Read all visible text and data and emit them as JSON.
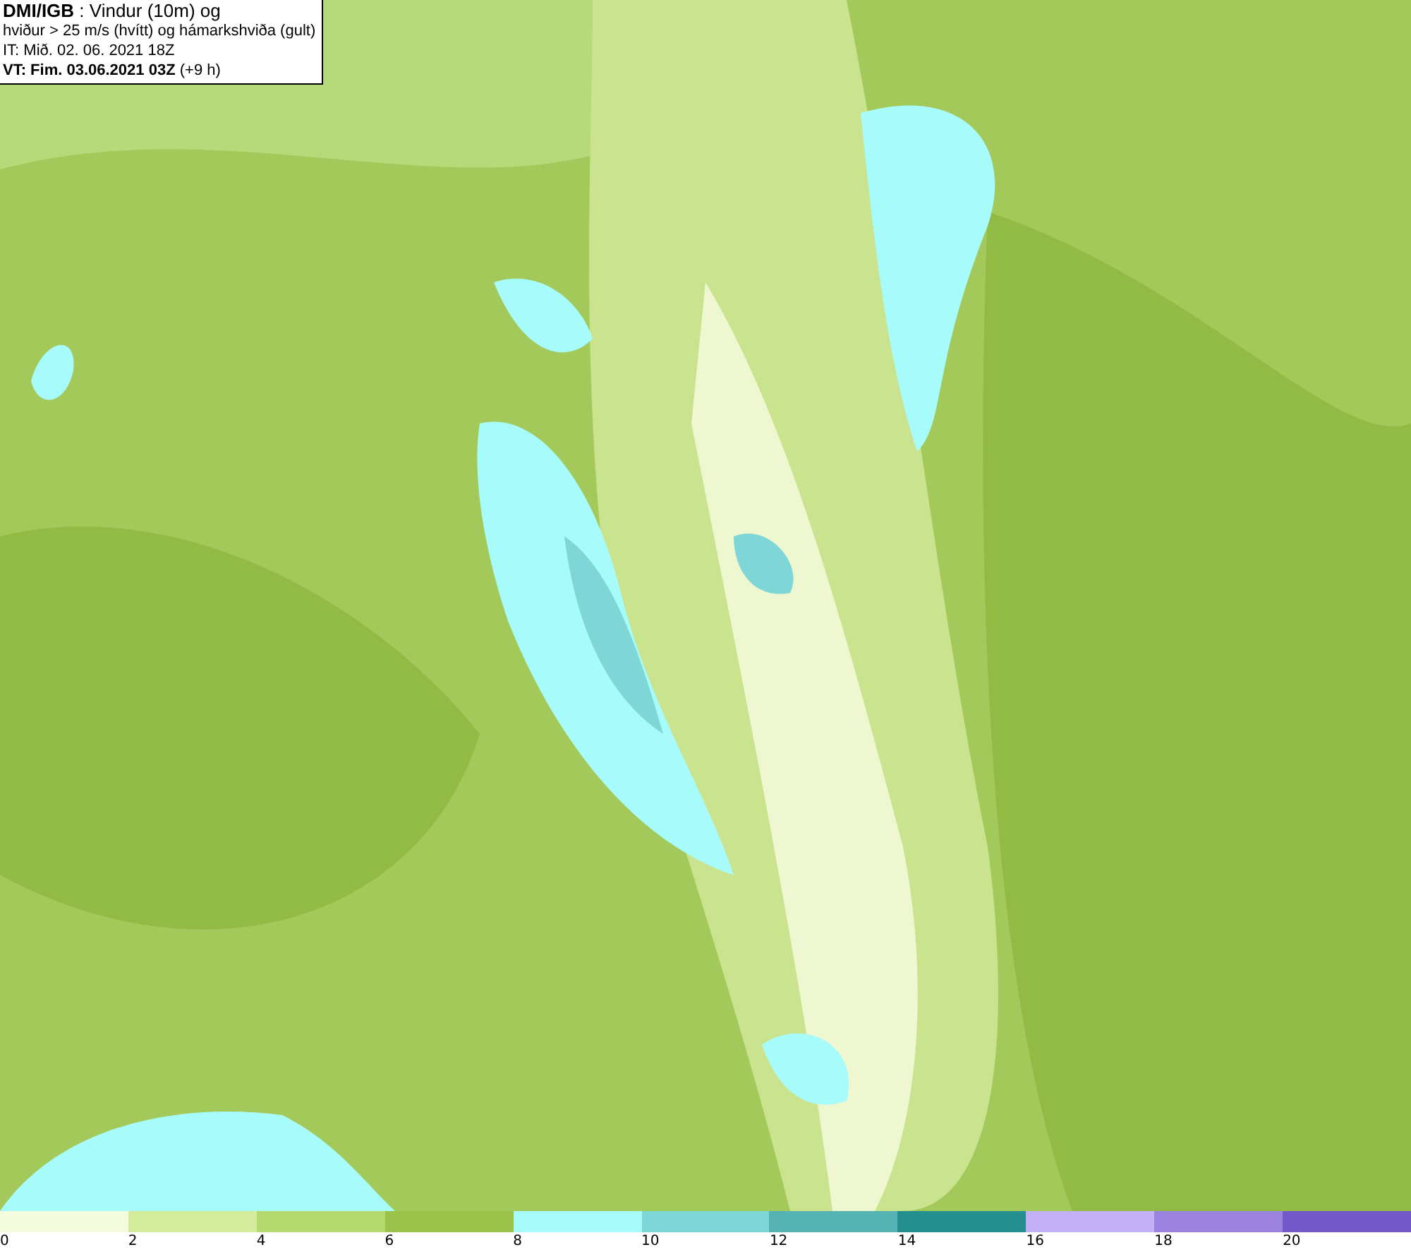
{
  "header": {
    "lines": [
      "**DMI/IGB** : Vindur (10m) og",
      "hviður > 25 m/s (hvítt) og hámarkshviða (gult)",
      "IT: Mið. 02. 06. 2021 18Z",
      "**VT: Fim. 03.06.2021 03Z** (+9 h)"
    ]
  },
  "legend": {
    "bins": [
      {
        "color": "#f5fbdf",
        "label": "0"
      },
      {
        "color": "#d4eb9c",
        "label": "2"
      },
      {
        "color": "#b5d86f",
        "label": "4"
      },
      {
        "color": "#9bc24a",
        "label": "6"
      },
      {
        "color": "#a8fbfb",
        "label": "8"
      },
      {
        "color": "#7fd6d6",
        "label": "10"
      },
      {
        "color": "#55b3b3",
        "label": "12"
      },
      {
        "color": "#238f8f",
        "label": "14"
      },
      {
        "color": "#c3b1f5",
        "label": "16"
      },
      {
        "color": "#9b82df",
        "label": "18"
      },
      {
        "color": "#7459c8",
        "label": "20"
      }
    ]
  }
}
